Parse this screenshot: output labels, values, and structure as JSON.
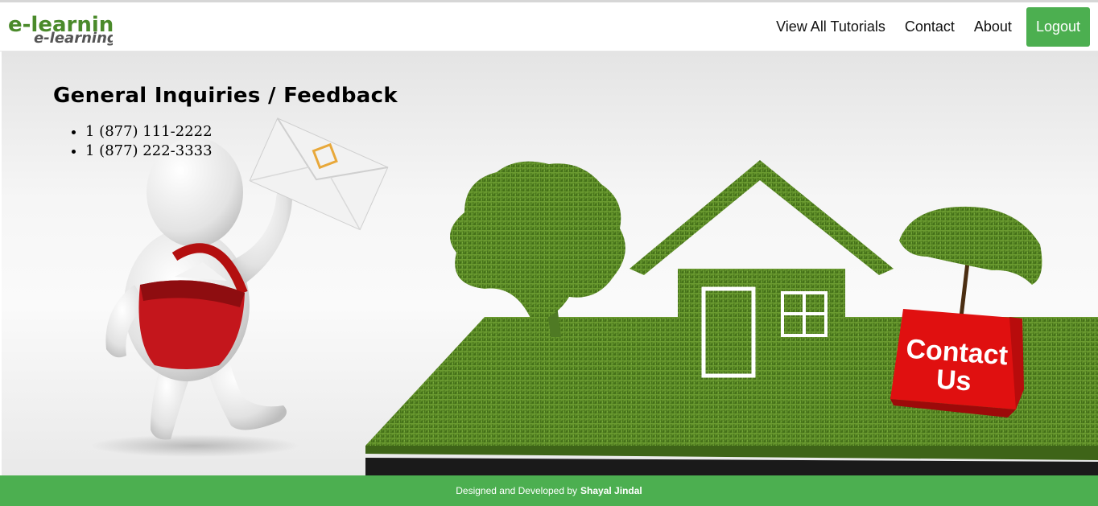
{
  "brand": {
    "logo_text": "e-learning",
    "logo_shadow_text": "e-learning"
  },
  "nav": {
    "items": [
      {
        "label": "View All Tutorials"
      },
      {
        "label": "Contact"
      },
      {
        "label": "About"
      }
    ],
    "logout_label": "Logout"
  },
  "main": {
    "heading": "General Inquiries / Feedback",
    "phones": [
      "1 (877) 111-2222",
      "1 (877) 222-3333"
    ],
    "sign_text_line1": "Contact",
    "sign_text_line2": "Us"
  },
  "footer": {
    "prefix": "Designed and Developed by",
    "author": "Shayal Jindal"
  },
  "colors": {
    "accent": "#4caf50",
    "grass": "#5e8f26",
    "sign_red": "#e01010"
  }
}
